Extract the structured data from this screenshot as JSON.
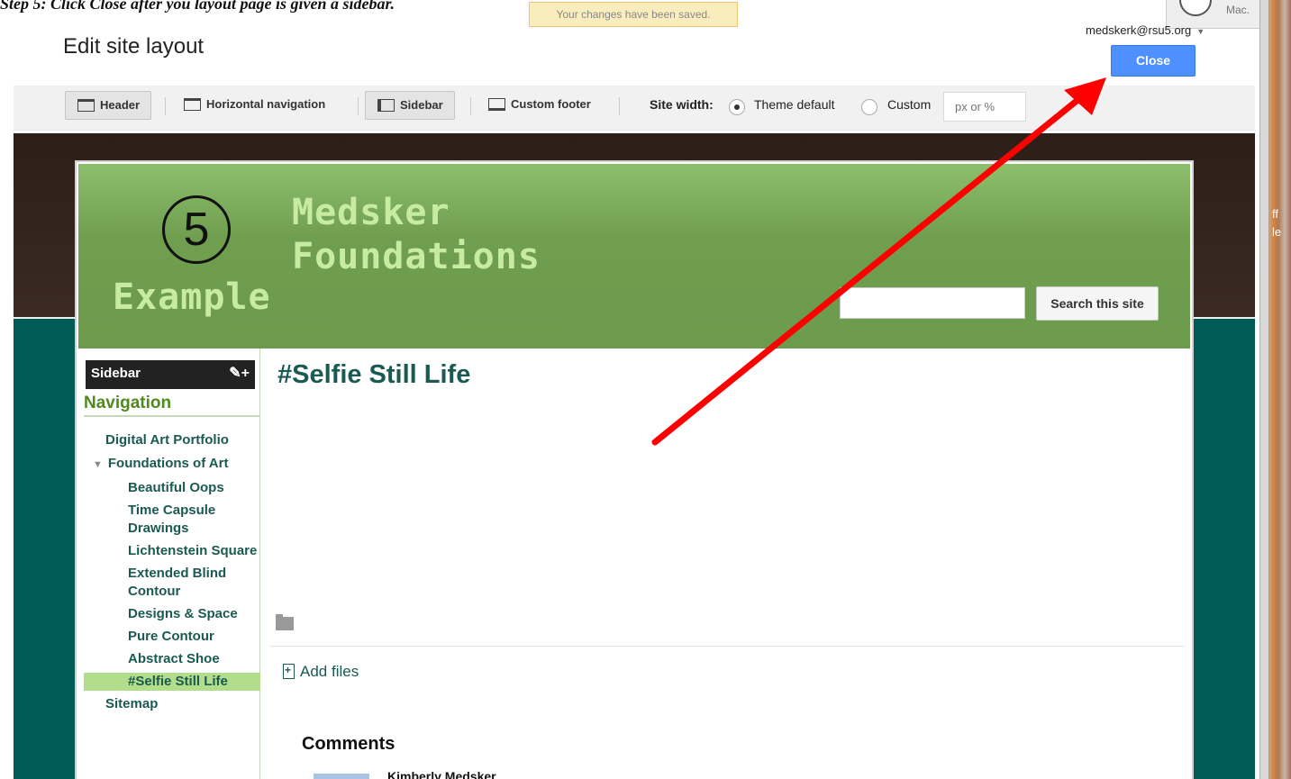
{
  "caption": "Step 5: Click Close after you layout page is given a sidebar.",
  "notification": "Your changes have been saved.",
  "page_title": "Edit site layout",
  "user": {
    "email": "medskerk@rsu5.org"
  },
  "mac_badge": "Mac.",
  "close_label": "Close",
  "toolbar": {
    "header_label": "Header",
    "horizontal_nav_label": "Horizontal navigation",
    "sidebar_label": "Sidebar",
    "custom_footer_label": "Custom footer",
    "site_width_label": "Site width:",
    "theme_default_label": "Theme default",
    "custom_label": "Custom",
    "width_placeholder": "px or %"
  },
  "site": {
    "step_number": "5",
    "title_line1": "Medsker",
    "title_line2": "Foundations",
    "subtitle": "Example",
    "search_button": "Search this site"
  },
  "sidebar": {
    "header": "Sidebar",
    "tools": "✎+",
    "nav_title": "Navigation",
    "items": [
      {
        "label": "Digital Art Portfolio",
        "level": 1
      },
      {
        "label": "Foundations of Art",
        "level": 1
      },
      {
        "label": "Beautiful Oops",
        "level": 2
      },
      {
        "label": "Time Capsule Drawings",
        "level": 2
      },
      {
        "label": "Lichtenstein Square",
        "level": 2
      },
      {
        "label": "Extended Blind Contour",
        "level": 2
      },
      {
        "label": "Designs & Space",
        "level": 2
      },
      {
        "label": "Pure Contour",
        "level": 2
      },
      {
        "label": "Abstract Shoe",
        "level": 2
      },
      {
        "label": "#Selfie Still Life",
        "level": 2,
        "selected": true
      },
      {
        "label": "Sitemap",
        "level": 1
      }
    ]
  },
  "content": {
    "heading": "#Selfie Still Life",
    "add_files": "Add files",
    "comments_heading": "Comments",
    "comment_author": "Kimberly Medsker"
  },
  "edge_text": "ff\nle",
  "colors": {
    "annotation_arrow": "#ff0000",
    "primary_button": "#4d90fe",
    "banner_green": "#6d9b4d",
    "link_teal": "#1a5a52",
    "selected_nav": "#b2dd8a"
  }
}
